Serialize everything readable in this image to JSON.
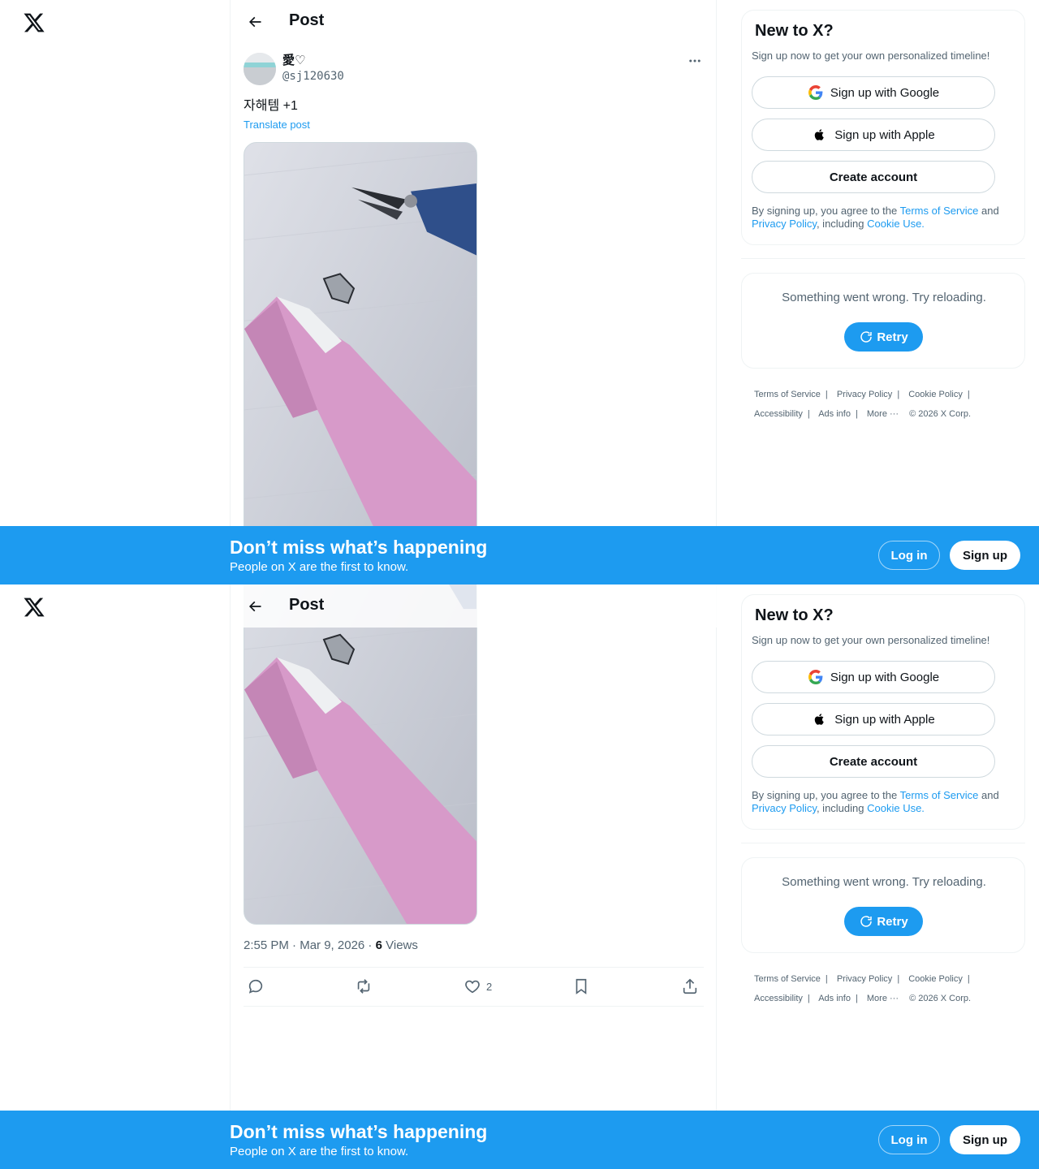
{
  "header": {
    "title": "Post"
  },
  "post": {
    "display_name": "愛♡",
    "handle": "@sj120630",
    "text": "자해템 +1",
    "translate_label": "Translate post",
    "time": "2:55 PM",
    "date": "Mar 9, 2026",
    "views_count": "6",
    "views_label": "Views",
    "likes_count": "2",
    "media_description": "pink eyebrow razor, blade fragment and blue pliers on grey wood surface"
  },
  "sidebar": {
    "new_title": "New to X?",
    "new_sub": "Sign up now to get your own personalized timeline!",
    "google_label": "Sign up with Google",
    "apple_label": "Sign up with Apple",
    "create_label": "Create account",
    "terms_prefix": "By signing up, you agree to the ",
    "terms_link": "Terms of Service",
    "terms_and": " and ",
    "privacy_link": "Privacy Policy",
    "including": ", including ",
    "cookie_link": "Cookie Use.",
    "error_text": "Something went wrong. Try reloading.",
    "retry_label": "Retry"
  },
  "footer": {
    "terms": "Terms of Service",
    "privacy": "Privacy Policy",
    "cookie": "Cookie Policy",
    "accessibility": "Accessibility",
    "ads": "Ads info",
    "more": "More ···",
    "copyright": "© 2026 X Corp."
  },
  "banner": {
    "title": "Don’t miss what’s happening",
    "sub": "People on X are the first to know.",
    "login": "Log in",
    "signup": "Sign up"
  },
  "colors": {
    "accent": "#1d9bf0",
    "text": "#0f1419",
    "secondary": "#536471",
    "border": "#eff3f4"
  }
}
